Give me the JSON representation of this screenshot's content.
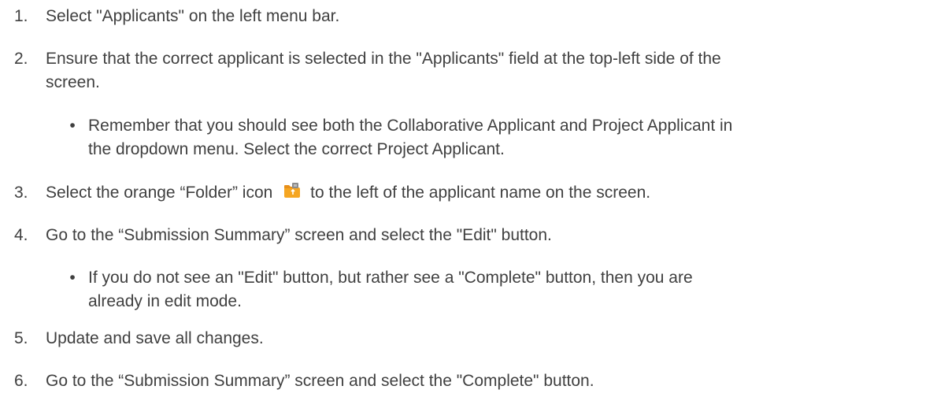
{
  "steps": [
    {
      "num": "1.",
      "text": "Select \"Applicants\" on the left menu bar."
    },
    {
      "num": "2.",
      "line1": "Ensure that the correct applicant is selected in the \"Applicants\" field at the top-left side of the",
      "line2": "screen."
    },
    {
      "num": "3.",
      "before": "Select the orange “Folder” icon",
      "after": "to the left of the applicant name on the screen."
    },
    {
      "num": "4.",
      "text": "Go to the “Submission Summary” screen and select the \"Edit\" button."
    },
    {
      "num": "5.",
      "text": "Update and save all changes."
    },
    {
      "num": "6.",
      "text": "Go to the “Submission Summary” screen and select the \"Complete\" button."
    }
  ],
  "bullets": [
    {
      "symbol": "•",
      "line1": "Remember that you should see both the Collaborative Applicant and Project Applicant in",
      "line2": "the dropdown menu. Select the correct Project Applicant."
    },
    {
      "symbol": "•",
      "line1": "If you do not see an \"Edit\" button, but rather see a \"Complete\" button, then you are",
      "line2": "already in edit mode."
    }
  ],
  "icons": {
    "folder": "folder-icon",
    "folder_color": "#F5A623"
  }
}
